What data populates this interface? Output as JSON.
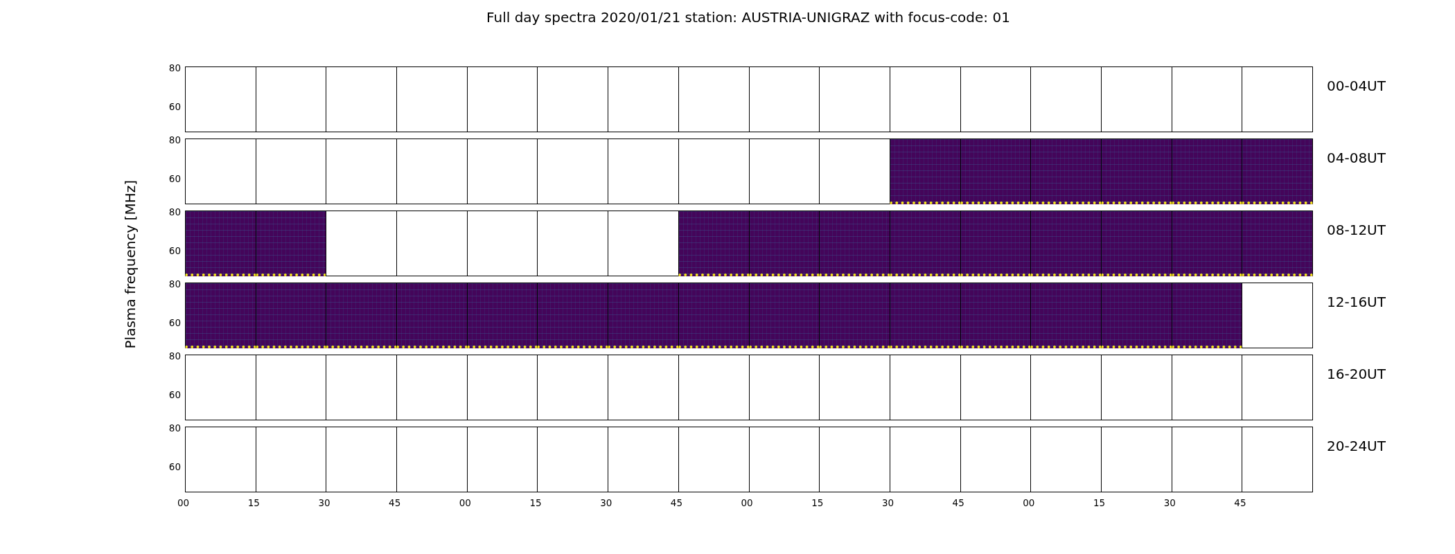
{
  "title": "Full day spectra 2020/01/21 station: AUSTRIA-UNIGRAZ with focus-code: 01",
  "y_label": "Plasma frequency [MHz]",
  "x_ticks": [
    "00",
    "15",
    "30",
    "45",
    "00",
    "15",
    "30",
    "45",
    "00",
    "15",
    "30",
    "45",
    "00",
    "15",
    "30",
    "45"
  ],
  "rows": [
    {
      "label": "00-04UT",
      "y_ticks": [
        "80",
        "60"
      ],
      "panels": [
        {
          "filled": false
        },
        {
          "filled": false
        },
        {
          "filled": false
        },
        {
          "filled": false
        },
        {
          "filled": false
        },
        {
          "filled": false
        },
        {
          "filled": false
        },
        {
          "filled": false
        },
        {
          "filled": false
        },
        {
          "filled": false
        },
        {
          "filled": false
        },
        {
          "filled": false
        },
        {
          "filled": false
        },
        {
          "filled": false
        },
        {
          "filled": false
        },
        {
          "filled": false
        }
      ]
    },
    {
      "label": "04-08UT",
      "y_ticks": [
        "80",
        "60"
      ],
      "panels": [
        {
          "filled": false
        },
        {
          "filled": false
        },
        {
          "filled": false
        },
        {
          "filled": false
        },
        {
          "filled": false
        },
        {
          "filled": false
        },
        {
          "filled": false
        },
        {
          "filled": false
        },
        {
          "filled": false
        },
        {
          "filled": false
        },
        {
          "filled": true
        },
        {
          "filled": true
        },
        {
          "filled": true
        },
        {
          "filled": true
        },
        {
          "filled": true
        },
        {
          "filled": true
        }
      ]
    },
    {
      "label": "08-12UT",
      "y_ticks": [
        "80",
        "60"
      ],
      "panels": [
        {
          "filled": true
        },
        {
          "filled": true
        },
        {
          "filled": false
        },
        {
          "filled": false
        },
        {
          "filled": false
        },
        {
          "filled": false
        },
        {
          "filled": false
        },
        {
          "filled": true
        },
        {
          "filled": true
        },
        {
          "filled": true
        },
        {
          "filled": true
        },
        {
          "filled": true
        },
        {
          "filled": true
        },
        {
          "filled": true
        },
        {
          "filled": true
        },
        {
          "filled": true
        }
      ]
    },
    {
      "label": "12-16UT",
      "y_ticks": [
        "80",
        "60"
      ],
      "panels": [
        {
          "filled": true
        },
        {
          "filled": true
        },
        {
          "filled": true
        },
        {
          "filled": true
        },
        {
          "filled": true
        },
        {
          "filled": true
        },
        {
          "filled": true
        },
        {
          "filled": true
        },
        {
          "filled": true
        },
        {
          "filled": true
        },
        {
          "filled": true
        },
        {
          "filled": true
        },
        {
          "filled": true
        },
        {
          "filled": true
        },
        {
          "filled": true
        },
        {
          "filled": false
        }
      ]
    },
    {
      "label": "16-20UT",
      "y_ticks": [
        "80",
        "60"
      ],
      "panels": [
        {
          "filled": false
        },
        {
          "filled": false
        },
        {
          "filled": false
        },
        {
          "filled": false
        },
        {
          "filled": false
        },
        {
          "filled": false
        },
        {
          "filled": false
        },
        {
          "filled": false
        },
        {
          "filled": false
        },
        {
          "filled": false
        },
        {
          "filled": false
        },
        {
          "filled": false
        },
        {
          "filled": false
        },
        {
          "filled": false
        },
        {
          "filled": false
        },
        {
          "filled": false
        }
      ]
    },
    {
      "label": "20-24UT",
      "y_ticks": [
        "80",
        "60"
      ],
      "panels": [
        {
          "filled": false
        },
        {
          "filled": false
        },
        {
          "filled": false
        },
        {
          "filled": false
        },
        {
          "filled": false
        },
        {
          "filled": false
        },
        {
          "filled": false
        },
        {
          "filled": false
        },
        {
          "filled": false
        },
        {
          "filled": false
        },
        {
          "filled": false
        },
        {
          "filled": false
        },
        {
          "filled": false
        },
        {
          "filled": false
        },
        {
          "filled": false
        },
        {
          "filled": false
        }
      ]
    }
  ]
}
